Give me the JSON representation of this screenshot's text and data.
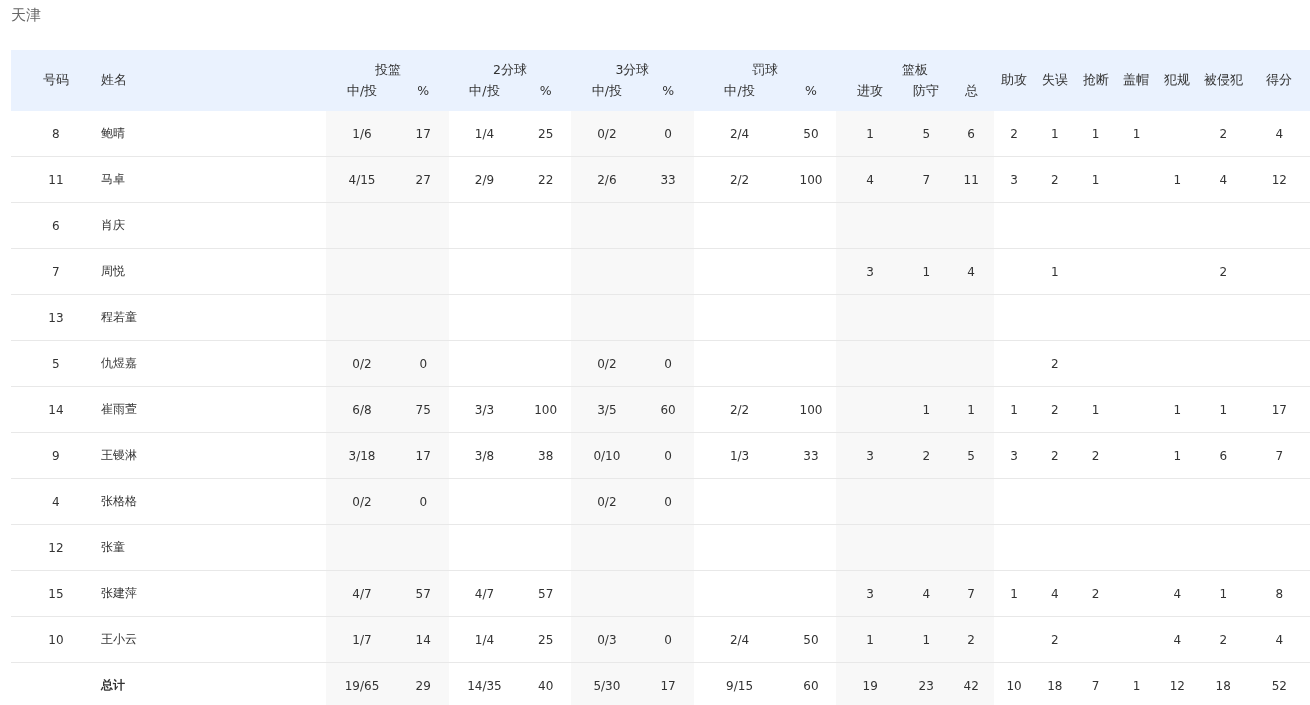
{
  "team_title": "天津",
  "columns": [
    {
      "label": "号码",
      "kind": "number"
    },
    {
      "label": "姓名",
      "kind": "name"
    },
    {
      "label": "投篮",
      "sub": [
        "中/投",
        "%"
      ]
    },
    {
      "label": "2分球",
      "sub": [
        "中/投",
        "%"
      ]
    },
    {
      "label": "3分球",
      "sub": [
        "中/投",
        "%"
      ]
    },
    {
      "label": "罚球",
      "sub": [
        "中/投",
        "%"
      ]
    },
    {
      "label": "篮板",
      "sub": [
        "进攻",
        "防守",
        "总"
      ]
    },
    {
      "label": "助攻"
    },
    {
      "label": "失误"
    },
    {
      "label": "抢断"
    },
    {
      "label": "盖帽"
    },
    {
      "label": "犯规"
    },
    {
      "label": "被侵犯"
    },
    {
      "label": "得分"
    }
  ],
  "rows": [
    {
      "kind": "player",
      "number": "8",
      "name": "鲍晴",
      "field_goals": "1/6",
      "field_goal_pct": "17",
      "two_pointers": "1/4",
      "two_point_pct": "25",
      "three_pointers": "0/2",
      "three_point_pct": "0",
      "free_throws": "2/4",
      "free_throw_pct": "50",
      "offensive_rebounds": "1",
      "defensive_rebounds": "5",
      "total_rebounds": "6",
      "assists": "2",
      "turnovers": "1",
      "steals": "1",
      "blocks": "1",
      "fouls_drawn": "2",
      "points": "4"
    },
    {
      "kind": "player",
      "number": "11",
      "name": "马卓",
      "field_goals": "4/15",
      "field_goal_pct": "27",
      "two_pointers": "2/9",
      "two_point_pct": "22",
      "three_pointers": "2/6",
      "three_point_pct": "33",
      "free_throws": "2/2",
      "free_throw_pct": "100",
      "offensive_rebounds": "4",
      "defensive_rebounds": "7",
      "total_rebounds": "11",
      "assists": "3",
      "turnovers": "2",
      "steals": "1",
      "fouls": "1",
      "fouls_drawn": "4",
      "points": "12"
    },
    {
      "kind": "player",
      "number": "6",
      "name": "肖庆"
    },
    {
      "kind": "player",
      "number": "7",
      "name": "周悦",
      "offensive_rebounds": "3",
      "defensive_rebounds": "1",
      "total_rebounds": "4",
      "turnovers": "1",
      "fouls_drawn": "2"
    },
    {
      "kind": "player",
      "number": "13",
      "name": "程若童"
    },
    {
      "kind": "player",
      "number": "5",
      "name": "仇煜嘉",
      "field_goals": "0/2",
      "field_goal_pct": "0",
      "three_pointers": "0/2",
      "three_point_pct": "0",
      "turnovers": "2"
    },
    {
      "kind": "player",
      "number": "14",
      "name": "崔雨萱",
      "field_goals": "6/8",
      "field_goal_pct": "75",
      "two_pointers": "3/3",
      "two_point_pct": "100",
      "three_pointers": "3/5",
      "three_point_pct": "60",
      "free_throws": "2/2",
      "free_throw_pct": "100",
      "defensive_rebounds": "1",
      "total_rebounds": "1",
      "assists": "1",
      "turnovers": "2",
      "steals": "1",
      "fouls": "1",
      "fouls_drawn": "1",
      "points": "17"
    },
    {
      "kind": "player",
      "number": "9",
      "name": "王镘淋",
      "field_goals": "3/18",
      "field_goal_pct": "17",
      "two_pointers": "3/8",
      "two_point_pct": "38",
      "three_pointers": "0/10",
      "three_point_pct": "0",
      "free_throws": "1/3",
      "free_throw_pct": "33",
      "offensive_rebounds": "3",
      "defensive_rebounds": "2",
      "total_rebounds": "5",
      "assists": "3",
      "turnovers": "2",
      "steals": "2",
      "fouls": "1",
      "fouls_drawn": "6",
      "points": "7"
    },
    {
      "kind": "player",
      "number": "4",
      "name": "张格格",
      "field_goals": "0/2",
      "field_goal_pct": "0",
      "three_pointers": "0/2",
      "three_point_pct": "0"
    },
    {
      "kind": "player",
      "number": "12",
      "name": "张童"
    },
    {
      "kind": "player",
      "number": "15",
      "name": "张建萍",
      "field_goals": "4/7",
      "field_goal_pct": "57",
      "two_pointers": "4/7",
      "two_point_pct": "57",
      "offensive_rebounds": "3",
      "defensive_rebounds": "4",
      "total_rebounds": "7",
      "assists": "1",
      "turnovers": "4",
      "steals": "2",
      "fouls": "4",
      "fouls_drawn": "1",
      "points": "8"
    },
    {
      "kind": "player",
      "number": "10",
      "name": "王小云",
      "field_goals": "1/7",
      "field_goal_pct": "14",
      "two_pointers": "1/4",
      "two_point_pct": "25",
      "three_pointers": "0/3",
      "three_point_pct": "0",
      "free_throws": "2/4",
      "free_throw_pct": "50",
      "offensive_rebounds": "1",
      "defensive_rebounds": "1",
      "total_rebounds": "2",
      "turnovers": "2",
      "fouls": "4",
      "fouls_drawn": "2",
      "points": "4"
    },
    {
      "kind": "total",
      "name": "总计",
      "field_goals": "19/65",
      "field_goal_pct": "29",
      "two_pointers": "14/35",
      "two_point_pct": "40",
      "three_pointers": "5/30",
      "three_point_pct": "17",
      "free_throws": "9/15",
      "free_throw_pct": "60",
      "offensive_rebounds": "19",
      "defensive_rebounds": "23",
      "total_rebounds": "42",
      "assists": "10",
      "turnovers": "18",
      "steals": "7",
      "blocks": "1",
      "fouls": "12",
      "fouls_drawn": "18",
      "points": "52"
    }
  ]
}
